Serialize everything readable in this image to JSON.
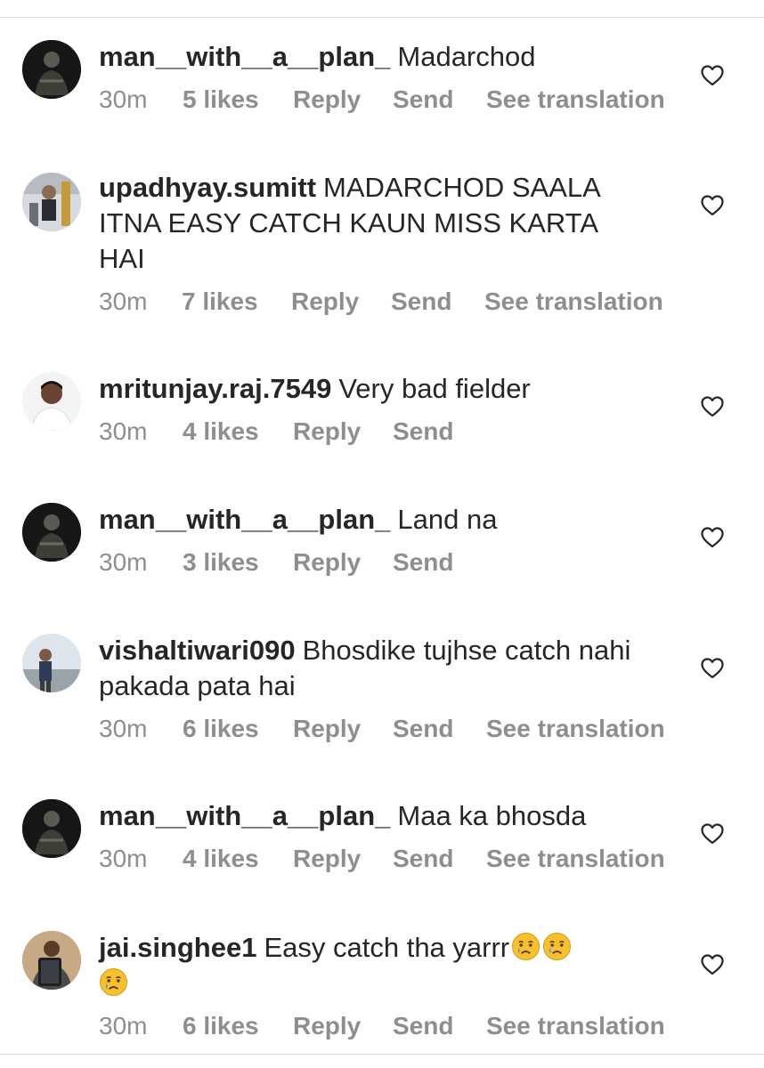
{
  "colors": {
    "text": "#262626",
    "meta": "#8e8e8e",
    "divider": "#e0e0e0"
  },
  "comments": [
    {
      "username": "man__with__a__plan_",
      "text": "Madarchod",
      "time": "30m",
      "likes": "5 likes",
      "reply": "Reply",
      "send": "Send",
      "translation": "See translation",
      "avatar_icon": "avatar-dark-figure"
    },
    {
      "username": "upadhyay.sumitt",
      "text": "MADARCHOD  SAALA ITNA EASY CATCH KAUN MISS KARTA HAI",
      "time": "30m",
      "likes": "7 likes",
      "reply": "Reply",
      "send": "Send",
      "translation": "See translation",
      "avatar_icon": "avatar-gym-photo"
    },
    {
      "username": "mritunjay.raj.7549",
      "text": "Very bad fielder",
      "time": "30m",
      "likes": "4 likes",
      "reply": "Reply",
      "send": "Send",
      "translation": "",
      "avatar_icon": "avatar-portrait"
    },
    {
      "username": "man__with__a__plan_",
      "text": "Land na",
      "time": "30m",
      "likes": "3 likes",
      "reply": "Reply",
      "send": "Send",
      "translation": "",
      "avatar_icon": "avatar-dark-figure"
    },
    {
      "username": "vishaltiwari090",
      "text": "Bhosdike tujhse catch nahi pakada pata hai",
      "time": "30m",
      "likes": "6 likes",
      "reply": "Reply",
      "send": "Send",
      "translation": "See translation",
      "avatar_icon": "avatar-outdoor-photo"
    },
    {
      "username": "man__with__a__plan_",
      "text": "Maa ka bhosda",
      "time": "30m",
      "likes": "4 likes",
      "reply": "Reply",
      "send": "Send",
      "translation": "See translation",
      "avatar_icon": "avatar-dark-figure"
    },
    {
      "username": "jai.singhee1",
      "text": "Easy catch tha yarrr",
      "text_emoji": "crying-face-emoji x3",
      "time": "30m",
      "likes": "6 likes",
      "reply": "Reply",
      "send": "Send",
      "translation": "See translation",
      "avatar_icon": "avatar-tablet-photo"
    }
  ]
}
